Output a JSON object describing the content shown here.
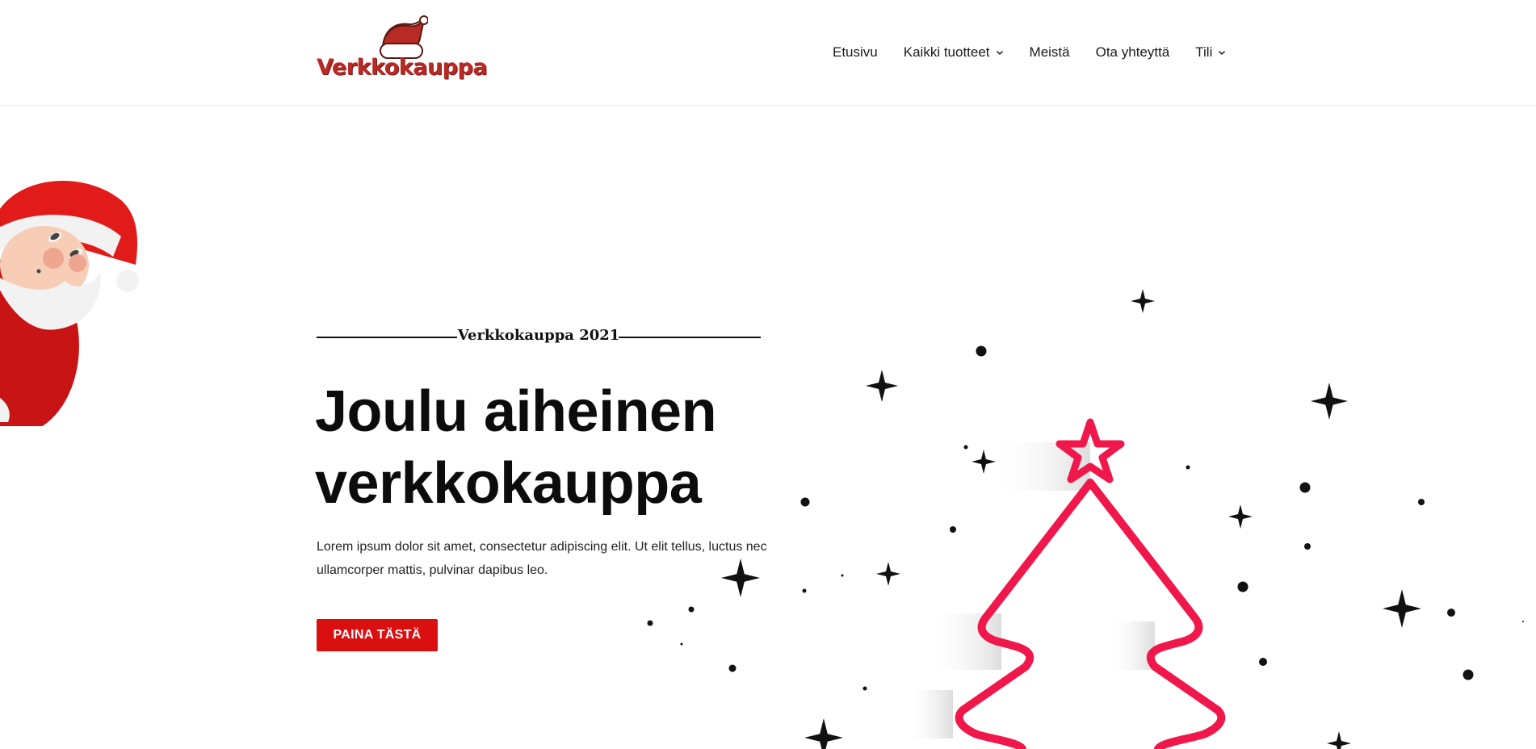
{
  "header": {
    "logo_text": "Verkkokauppa",
    "nav": [
      {
        "label": "Etusivu",
        "dropdown": false
      },
      {
        "label": "Kaikki tuotteet",
        "dropdown": true
      },
      {
        "label": "Meistä",
        "dropdown": false
      },
      {
        "label": "Ota yhteyttä",
        "dropdown": false
      },
      {
        "label": "Tili",
        "dropdown": true
      }
    ]
  },
  "hero": {
    "eyebrow": "Verkkokauppa 2021",
    "title": "Joulu aiheinen verkkokauppa",
    "text": "Lorem ipsum dolor sit amet, consectetur adipiscing elit. Ut elit tellus, luctus nec ullamcorper mattis, pulvinar dapibus leo.",
    "cta_label": "PAINA TÄSTÄ"
  },
  "colors": {
    "accent": "#d90f10",
    "logo": "#b82a26",
    "tree": "#f0174a",
    "text": "#111111"
  },
  "icons": [
    "santa-hat-logo",
    "chevron-down-icon",
    "santa-illustration",
    "christmas-tree-illustration",
    "star-icon"
  ]
}
